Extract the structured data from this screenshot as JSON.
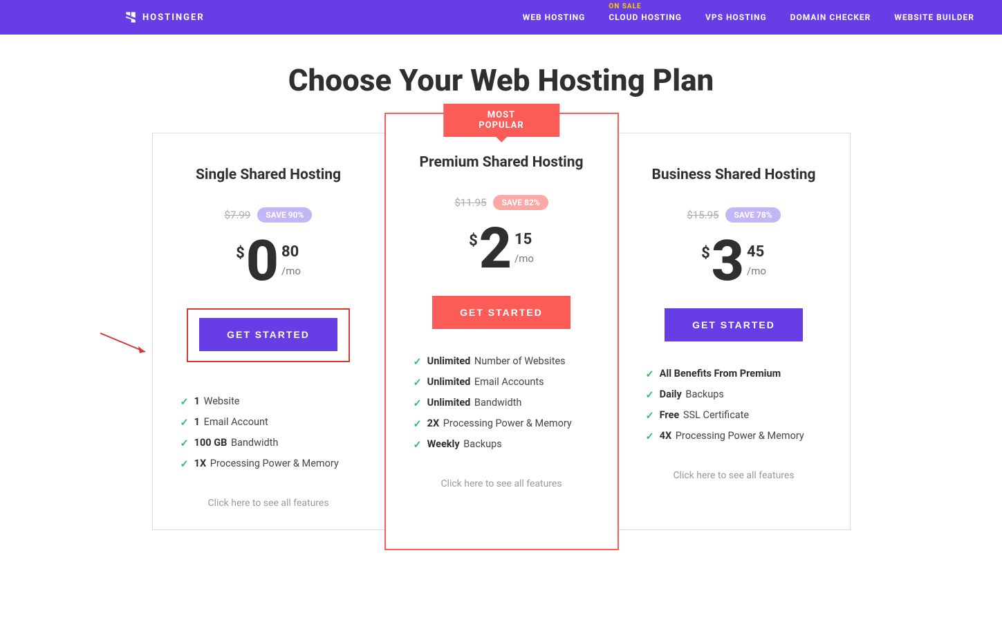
{
  "brand": "HOSTINGER",
  "nav": {
    "items": [
      {
        "label": "WEB HOSTING"
      },
      {
        "label": "CLOUD HOSTING",
        "on_sale": "ON SALE"
      },
      {
        "label": "VPS HOSTING"
      },
      {
        "label": "DOMAIN CHECKER"
      },
      {
        "label": "WEBSITE BUILDER"
      }
    ]
  },
  "page_title": "Choose Your Web Hosting Plan",
  "ribbon": "MOST POPULAR",
  "per_label": "/mo",
  "see_all": "Click here to see all features",
  "plans": [
    {
      "title": "Single Shared Hosting",
      "old_price": "$7.99",
      "save": "SAVE 90%",
      "currency": "$",
      "main": "0",
      "cents": "80",
      "cta": "GET STARTED",
      "features": [
        {
          "bold": "1",
          "rest": " Website"
        },
        {
          "bold": "1",
          "rest": " Email Account"
        },
        {
          "bold": "100 GB",
          "rest": " Bandwidth"
        },
        {
          "bold": "1X",
          "rest": " Processing Power & Memory"
        }
      ]
    },
    {
      "title": "Premium Shared Hosting",
      "old_price": "$11.95",
      "save": "SAVE 82%",
      "currency": "$",
      "main": "2",
      "cents": "15",
      "cta": "GET STARTED",
      "features": [
        {
          "bold": "Unlimited",
          "rest": " Number of Websites"
        },
        {
          "bold": "Unlimited",
          "rest": " Email Accounts"
        },
        {
          "bold": "Unlimited",
          "rest": " Bandwidth"
        },
        {
          "bold": "2X",
          "rest": " Processing Power & Memory"
        },
        {
          "bold": "Weekly",
          "rest": " Backups"
        }
      ]
    },
    {
      "title": "Business Shared Hosting",
      "old_price": "$15.95",
      "save": "SAVE 78%",
      "currency": "$",
      "main": "3",
      "cents": "45",
      "cta": "GET STARTED",
      "features": [
        {
          "bold": "All Benefits From Premium",
          "rest": ""
        },
        {
          "bold": "Daily",
          "rest": " Backups"
        },
        {
          "bold": "Free",
          "rest": " SSL Certificate"
        },
        {
          "bold": "4X",
          "rest": " Processing Power & Memory"
        }
      ]
    }
  ]
}
